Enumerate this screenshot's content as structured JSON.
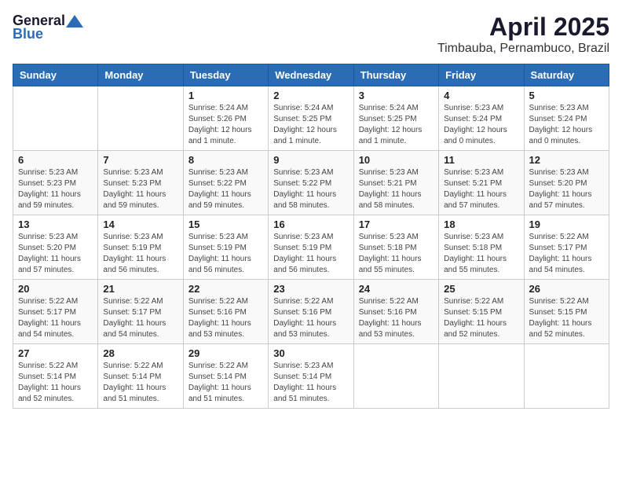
{
  "header": {
    "logo_general": "General",
    "logo_blue": "Blue",
    "month_title": "April 2025",
    "location": "Timbauba, Pernambuco, Brazil"
  },
  "weekdays": [
    "Sunday",
    "Monday",
    "Tuesday",
    "Wednesday",
    "Thursday",
    "Friday",
    "Saturday"
  ],
  "weeks": [
    [
      {
        "day": "",
        "info": ""
      },
      {
        "day": "",
        "info": ""
      },
      {
        "day": "1",
        "info": "Sunrise: 5:24 AM\nSunset: 5:26 PM\nDaylight: 12 hours and 1 minute."
      },
      {
        "day": "2",
        "info": "Sunrise: 5:24 AM\nSunset: 5:25 PM\nDaylight: 12 hours and 1 minute."
      },
      {
        "day": "3",
        "info": "Sunrise: 5:24 AM\nSunset: 5:25 PM\nDaylight: 12 hours and 1 minute."
      },
      {
        "day": "4",
        "info": "Sunrise: 5:23 AM\nSunset: 5:24 PM\nDaylight: 12 hours and 0 minutes."
      },
      {
        "day": "5",
        "info": "Sunrise: 5:23 AM\nSunset: 5:24 PM\nDaylight: 12 hours and 0 minutes."
      }
    ],
    [
      {
        "day": "6",
        "info": "Sunrise: 5:23 AM\nSunset: 5:23 PM\nDaylight: 11 hours and 59 minutes."
      },
      {
        "day": "7",
        "info": "Sunrise: 5:23 AM\nSunset: 5:23 PM\nDaylight: 11 hours and 59 minutes."
      },
      {
        "day": "8",
        "info": "Sunrise: 5:23 AM\nSunset: 5:22 PM\nDaylight: 11 hours and 59 minutes."
      },
      {
        "day": "9",
        "info": "Sunrise: 5:23 AM\nSunset: 5:22 PM\nDaylight: 11 hours and 58 minutes."
      },
      {
        "day": "10",
        "info": "Sunrise: 5:23 AM\nSunset: 5:21 PM\nDaylight: 11 hours and 58 minutes."
      },
      {
        "day": "11",
        "info": "Sunrise: 5:23 AM\nSunset: 5:21 PM\nDaylight: 11 hours and 57 minutes."
      },
      {
        "day": "12",
        "info": "Sunrise: 5:23 AM\nSunset: 5:20 PM\nDaylight: 11 hours and 57 minutes."
      }
    ],
    [
      {
        "day": "13",
        "info": "Sunrise: 5:23 AM\nSunset: 5:20 PM\nDaylight: 11 hours and 57 minutes."
      },
      {
        "day": "14",
        "info": "Sunrise: 5:23 AM\nSunset: 5:19 PM\nDaylight: 11 hours and 56 minutes."
      },
      {
        "day": "15",
        "info": "Sunrise: 5:23 AM\nSunset: 5:19 PM\nDaylight: 11 hours and 56 minutes."
      },
      {
        "day": "16",
        "info": "Sunrise: 5:23 AM\nSunset: 5:19 PM\nDaylight: 11 hours and 56 minutes."
      },
      {
        "day": "17",
        "info": "Sunrise: 5:23 AM\nSunset: 5:18 PM\nDaylight: 11 hours and 55 minutes."
      },
      {
        "day": "18",
        "info": "Sunrise: 5:23 AM\nSunset: 5:18 PM\nDaylight: 11 hours and 55 minutes."
      },
      {
        "day": "19",
        "info": "Sunrise: 5:22 AM\nSunset: 5:17 PM\nDaylight: 11 hours and 54 minutes."
      }
    ],
    [
      {
        "day": "20",
        "info": "Sunrise: 5:22 AM\nSunset: 5:17 PM\nDaylight: 11 hours and 54 minutes."
      },
      {
        "day": "21",
        "info": "Sunrise: 5:22 AM\nSunset: 5:17 PM\nDaylight: 11 hours and 54 minutes."
      },
      {
        "day": "22",
        "info": "Sunrise: 5:22 AM\nSunset: 5:16 PM\nDaylight: 11 hours and 53 minutes."
      },
      {
        "day": "23",
        "info": "Sunrise: 5:22 AM\nSunset: 5:16 PM\nDaylight: 11 hours and 53 minutes."
      },
      {
        "day": "24",
        "info": "Sunrise: 5:22 AM\nSunset: 5:16 PM\nDaylight: 11 hours and 53 minutes."
      },
      {
        "day": "25",
        "info": "Sunrise: 5:22 AM\nSunset: 5:15 PM\nDaylight: 11 hours and 52 minutes."
      },
      {
        "day": "26",
        "info": "Sunrise: 5:22 AM\nSunset: 5:15 PM\nDaylight: 11 hours and 52 minutes."
      }
    ],
    [
      {
        "day": "27",
        "info": "Sunrise: 5:22 AM\nSunset: 5:14 PM\nDaylight: 11 hours and 52 minutes."
      },
      {
        "day": "28",
        "info": "Sunrise: 5:22 AM\nSunset: 5:14 PM\nDaylight: 11 hours and 51 minutes."
      },
      {
        "day": "29",
        "info": "Sunrise: 5:22 AM\nSunset: 5:14 PM\nDaylight: 11 hours and 51 minutes."
      },
      {
        "day": "30",
        "info": "Sunrise: 5:23 AM\nSunset: 5:14 PM\nDaylight: 11 hours and 51 minutes."
      },
      {
        "day": "",
        "info": ""
      },
      {
        "day": "",
        "info": ""
      },
      {
        "day": "",
        "info": ""
      }
    ]
  ]
}
